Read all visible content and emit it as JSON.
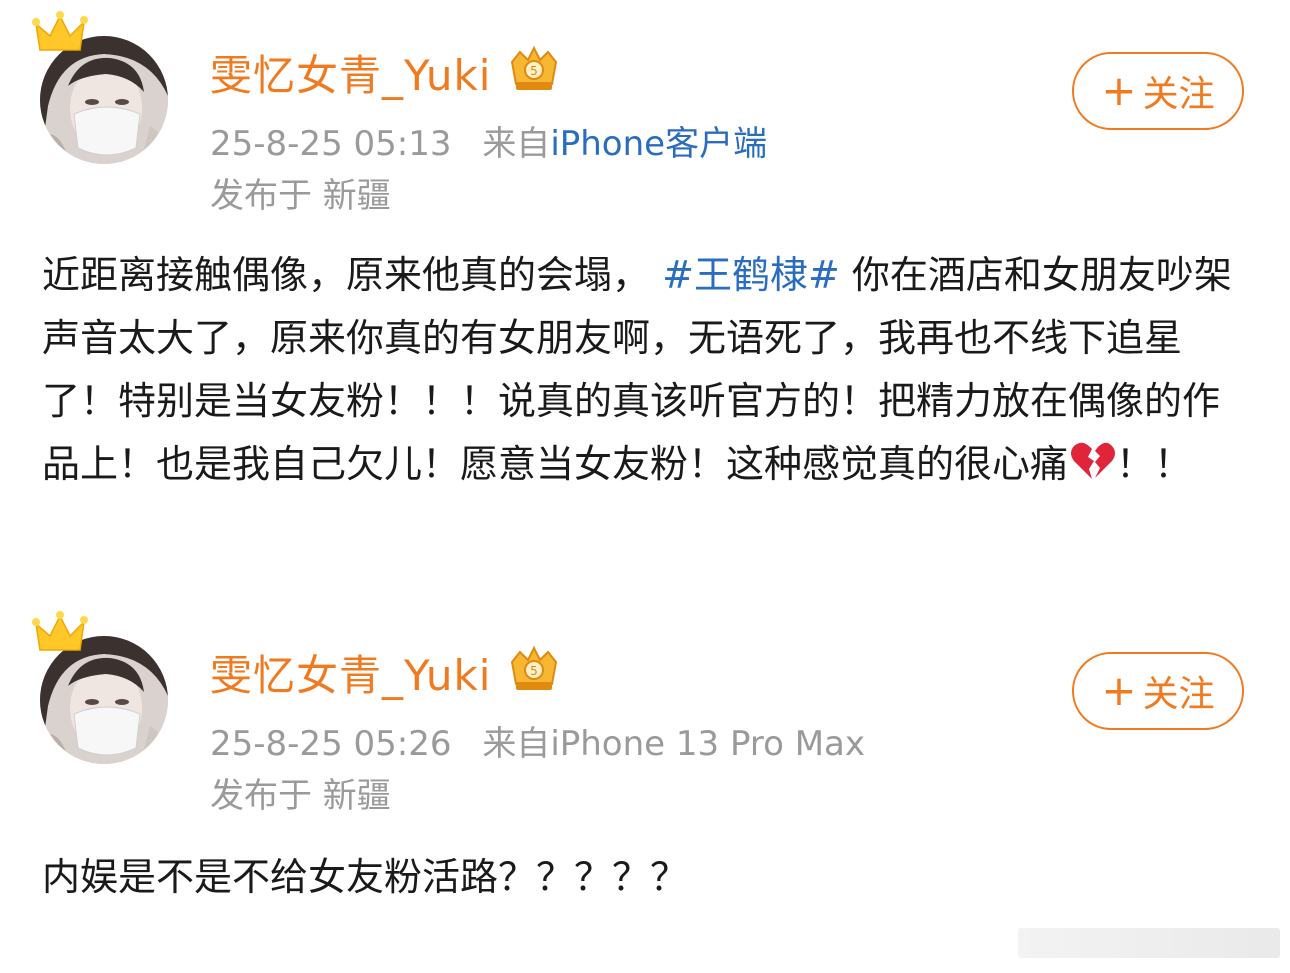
{
  "posts": [
    {
      "username": "雯忆女青_Yuki",
      "time": "25-8-25 05:13",
      "source_prefix": "来自",
      "source": "iPhone客户端",
      "location": "发布于 新疆",
      "follow_plus": "+",
      "follow_label": "关注",
      "content_before_tag": "近距离接触偶像，原来他真的会塌，",
      "hashtag": "#王鹤棣#",
      "content_after_tag": "你在酒店和女朋友吵架声音太大了，原来你真的有女朋友啊，无语死了，我再也不线下追星了！特别是当女友粉！！！说真的真该听官方的！把精力放在偶像的作品上！也是我自己欠儿！愿意当女友粉！这种感觉真的很心痛",
      "content_tail": "！！",
      "emoji": "broken-heart-icon"
    },
    {
      "username": "雯忆女青_Yuki",
      "time": "25-8-25 05:26",
      "source_prefix": "来自",
      "source": "iPhone 13 Pro Max",
      "location": "发布于 新疆",
      "follow_plus": "+",
      "follow_label": "关注",
      "content": "内娱是不是不给女友粉活路？？？？？"
    }
  ],
  "colors": {
    "username": "#f07a20",
    "link": "#2a6dbf",
    "meta": "#9a9a9a",
    "follow_border": "#f07a20"
  }
}
